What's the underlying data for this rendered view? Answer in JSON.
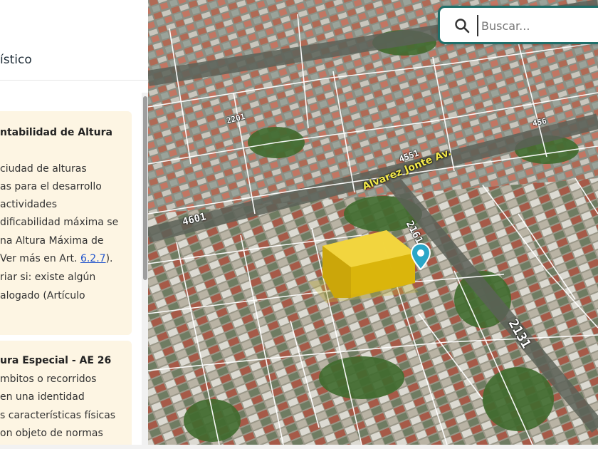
{
  "panel": {
    "title": "ístico",
    "cards": [
      {
        "title": "ntabilidad de Altura",
        "lines": [
          {
            "text": "ciudad de alturas"
          },
          {
            "text": "as para el desarrollo"
          },
          {
            "text": "actividades"
          },
          {
            "text": "dificabilidad máxima se"
          },
          {
            "text": "na Altura Máxima de"
          },
          {
            "text": "Ver más en Art. ",
            "link": "6.2.7",
            "after": ")."
          },
          {
            "text": "riar si: existe algún"
          },
          {
            "text": "alogado (Artículo"
          }
        ]
      },
      {
        "title": "ura Especial - AE 26",
        "lines": [
          {
            "text": "mbitos o recorridos"
          },
          {
            "text": "en una identidad"
          },
          {
            "text": "s características físicas"
          },
          {
            "text": "on objeto de normas"
          }
        ]
      }
    ]
  },
  "search": {
    "placeholder": "Buscar...",
    "value": ""
  },
  "map": {
    "street_name": "Alvarez Jonte Av.",
    "numbers": [
      "4551",
      "4601",
      "2161",
      "2131",
      "2201",
      "456"
    ],
    "colors": {
      "building_highlight": "#e8c514",
      "marker": "#2aa6c8",
      "street_label": "#f3e94a",
      "parcel_lines": "#ffffff"
    }
  },
  "icons": {
    "search": "search-icon",
    "marker": "map-pin-icon"
  }
}
